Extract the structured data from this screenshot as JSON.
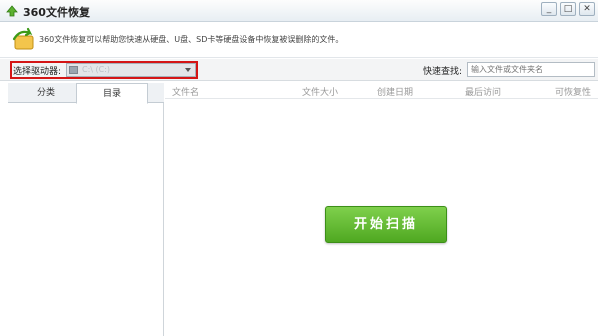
{
  "window": {
    "title": "360文件恢复",
    "minimize_glyph": "_",
    "maximize_glyph": "□",
    "close_glyph": "✕"
  },
  "info": {
    "description": "360文件恢复可以帮助您快速从硬盘、U盘、SD卡等硬盘设备中恢复被误删除的文件。"
  },
  "drive": {
    "label": "选择驱动器:",
    "value": "C:\\ (C:)"
  },
  "quick_search": {
    "label": "快速查找:",
    "placeholder": "输入文件或文件夹名"
  },
  "sidebar": {
    "tabs": [
      {
        "label": "分类",
        "active": false
      },
      {
        "label": "目录",
        "active": true
      }
    ]
  },
  "table": {
    "columns": [
      "文件名",
      "文件大小",
      "创建日期",
      "最后访问",
      "可恢复性"
    ]
  },
  "scan_button": {
    "label": "开始扫描"
  },
  "colors": {
    "accent_green": "#4fa821",
    "highlight_red": "#d41515"
  },
  "icons": [
    "app-logo-icon",
    "restore-arrow-icon",
    "drive-icon",
    "dropdown-arrow-icon"
  ]
}
